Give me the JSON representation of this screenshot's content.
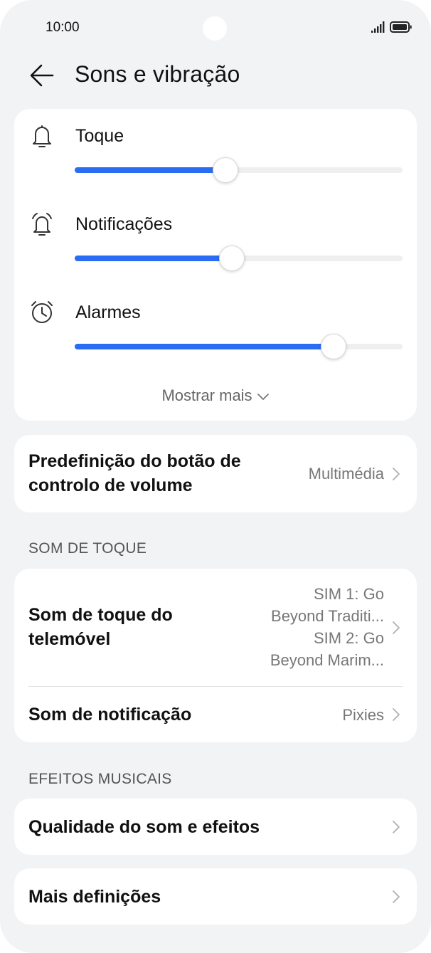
{
  "status_bar": {
    "time": "10:00",
    "signal_icon": "signal-icon",
    "battery_icon": "battery-icon"
  },
  "header": {
    "back_icon": "arrow-left-icon",
    "title": "Sons e vibração"
  },
  "volume": {
    "items": [
      {
        "label": "Toque",
        "icon": "bell-icon",
        "level_percent": 46
      },
      {
        "label": "Notificações",
        "icon": "notification-bell-icon",
        "level_percent": 48
      },
      {
        "label": "Alarmes",
        "icon": "alarm-clock-icon",
        "level_percent": 79
      }
    ],
    "show_more": "Mostrar mais"
  },
  "volume_button": {
    "title_line1": "Predefinição do botão de",
    "title_line2": "controlo de volume",
    "value": "Multimédia"
  },
  "sections": {
    "ringtone": "SOM DE TOQUE",
    "music_effects": "EFEITOS MUSICAIS"
  },
  "ringtone": {
    "phone_title_line1": "Som de toque do",
    "phone_title_line2": "telemóvel",
    "sim1_line1": "SIM 1: Go",
    "sim1_line2": "Beyond Traditi...",
    "sim2_line1": "SIM 2: Go",
    "sim2_line2": "Beyond Marim...",
    "notification_title": "Som de notificação",
    "notification_value": "Pixies"
  },
  "effects": {
    "title": "Qualidade do som e efeitos"
  },
  "more": {
    "title": "Mais definições"
  },
  "colors": {
    "accent": "#2a6cf4",
    "background": "#f1f3f5",
    "card": "#ffffff"
  }
}
